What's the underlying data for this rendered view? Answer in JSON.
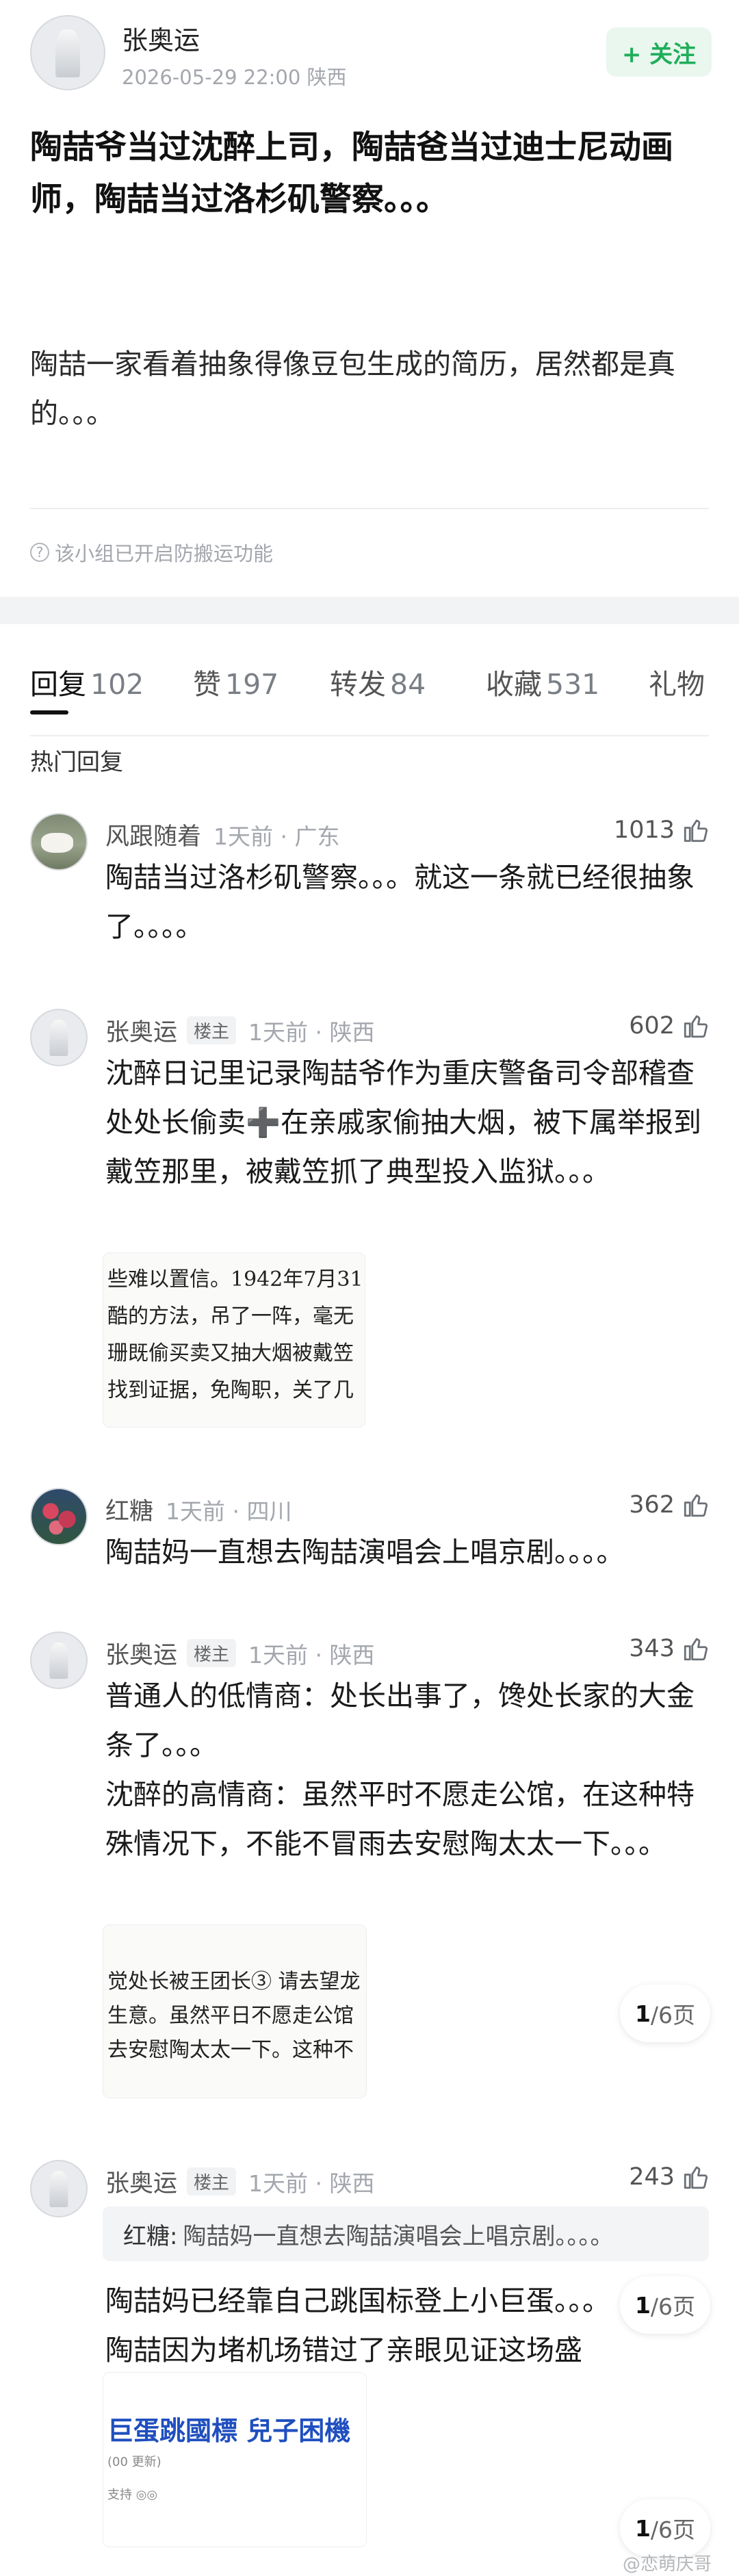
{
  "post": {
    "author": "张奥运",
    "meta": "2026-05-29 22:00  陕西",
    "follow_label": "+ 关注",
    "title": "陶喆爷当过沈醉上司，陶喆爸当过迪士尼动画师，陶喆当过洛杉矶警察。。。",
    "body": "陶喆一家看着抽象得像豆包生成的简历，居然都是真的。。。",
    "anti_repost_note": "该小组已开启防搬运功能"
  },
  "tabs": [
    {
      "label": "回复",
      "count": "102"
    },
    {
      "label": "赞",
      "count": "197"
    },
    {
      "label": "转发",
      "count": "84"
    },
    {
      "label": "收藏",
      "count": "531"
    },
    {
      "label": "礼物",
      "count": ""
    }
  ],
  "hot_replies_title": "热门回复",
  "comments": [
    {
      "user": "风跟随着",
      "badge": "",
      "meta": "1天前 · 广东",
      "likes": "1013",
      "text": "陶喆当过洛杉矶警察。。。就这一条就已经很抽象了。。。。"
    },
    {
      "user": "张奥运",
      "badge": "楼主",
      "meta": "1天前 · 陕西",
      "likes": "602",
      "text": "沈醉日记里记录陶喆爷作为重庆警备司令部稽查处处长偷卖➕在亲戚家偷抽大烟，被下属举报到戴笠那里，被戴笠抓了典型投入监狱。。。",
      "image_lines": [
        "些难以置信。1942年7月31",
        "酷的方法，吊了一阵，毫无",
        "珊既偷买卖又抽大烟被戴笠",
        "找到证据，免陶职，关了几"
      ]
    },
    {
      "user": "红糖",
      "badge": "",
      "meta": "1天前 · 四川",
      "likes": "362",
      "text": "陶喆妈一直想去陶喆演唱会上唱京剧。。。。"
    },
    {
      "user": "张奥运",
      "badge": "楼主",
      "meta": "1天前 · 陕西",
      "likes": "343",
      "text_lines": [
        "普通人的低情商：处长出事了，馋处长家的大金条了。。。",
        "沈醉的高情商：虽然平时不愿走公馆，在这种特殊情况下，不能不冒雨去安慰陶太太一下。。。"
      ],
      "image_lines": [
        "觉处长被王团长③ 请去望龙",
        "生意。虽然平日不愿走公馆",
        "去安慰陶太太一下。这种不"
      ],
      "pager_current": "1",
      "pager_total": "/6页"
    },
    {
      "user": "张奥运",
      "badge": "楼主",
      "meta": "1天前 · 陕西",
      "likes": "243",
      "quote_user": "红糖:",
      "quote_text": "陶喆妈一直想去陶喆演唱会上唱京剧。。。。",
      "text": "陶喆妈已经靠自己跳国标登上小巨蛋。。。陶喆因为堵机场错过了亲眼见证这场盛事。。。",
      "image_headline": "巨蛋跳國標 兒子困機",
      "image_sub1": "(00 更新)",
      "image_sub2": "支持 ◎◎",
      "pager_current": "1",
      "pager_total": "/6页",
      "pager2_current": "1",
      "pager2_total": "/6页"
    }
  ],
  "watermark": "@恋萌庆哥",
  "colors": {
    "accent_green": "#1fae5a",
    "follow_bg": "#e9f7ee",
    "meta_gray": "#a3a7ad"
  }
}
